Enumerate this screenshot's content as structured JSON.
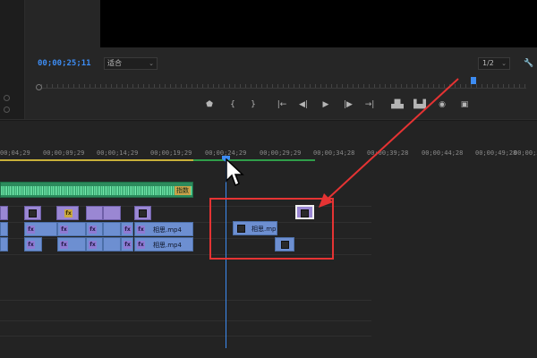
{
  "monitor": {
    "timecode": "00;00;25;11",
    "fit_label": "适合",
    "resolution_label": "1/2"
  },
  "transport": {
    "buttons": [
      {
        "name": "add-marker-button",
        "glyph": "⬟"
      },
      {
        "name": "mark-in-button",
        "glyph": "{"
      },
      {
        "name": "mark-out-button",
        "glyph": "}"
      },
      {
        "name": "go-to-in-button",
        "glyph": "|←"
      },
      {
        "name": "step-back-button",
        "glyph": "◀|"
      },
      {
        "name": "play-button",
        "glyph": "▶"
      },
      {
        "name": "step-forward-button",
        "glyph": "|▶"
      },
      {
        "name": "go-to-out-button",
        "glyph": "→|"
      },
      {
        "name": "lift-button",
        "glyph": "▟▙"
      },
      {
        "name": "extract-button",
        "glyph": "▙▟"
      },
      {
        "name": "export-frame-button",
        "glyph": "◉"
      },
      {
        "name": "comparison-view-button",
        "glyph": "▣"
      }
    ]
  },
  "ruler": {
    "ticks": [
      "00;04;29",
      "00;00;09;29",
      "00;00;14;29",
      "00;00;19;29",
      "00;00;24;29",
      "00;00;29;29",
      "00;00;34;28",
      "00;00;39;28",
      "00;00;44;28",
      "00;00;49;28",
      "00;00;54"
    ]
  },
  "clips": {
    "v2_name_a": "相思.mp4",
    "v2_name_b": "相思.mp4",
    "v2_name_c": "相思.mp",
    "audio_label": "指数"
  },
  "colors": {
    "accent": "#3d8cf2",
    "video_clip": "#6d8fd1",
    "title_clip": "#9a87d3",
    "audio_clip": "#2c8a5c",
    "annotation": "#e53333"
  }
}
